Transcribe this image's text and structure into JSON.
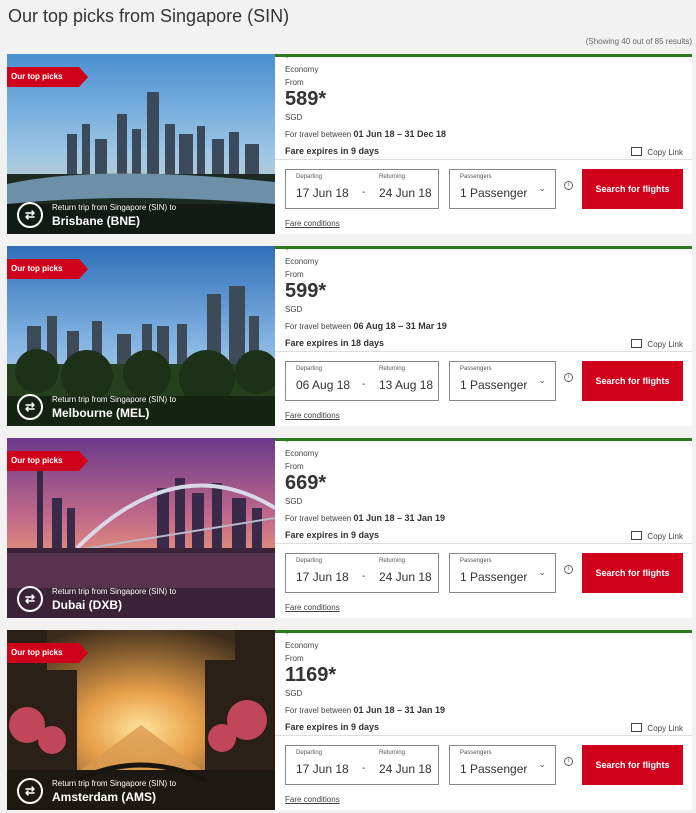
{
  "page": {
    "title": "Our top picks from Singapore (SIN)",
    "results": "(Showing 40 out of 85 results)"
  },
  "common": {
    "badge": "Our top picks",
    "route_prefix": "Return trip from Singapore (SIN) to",
    "cabin": "Economy",
    "from": "From",
    "currency": "SGD",
    "travel_prefix": "For travel between",
    "copy_link": "Copy Link",
    "departing_label": "Departing",
    "returning_label": "Returning",
    "passengers_label": "Passengers",
    "passengers_value": "1 Passenger",
    "search_button": "Search for flights",
    "fare_conditions": "Fare conditions",
    "date_separator": "-",
    "info_glyph": "i"
  },
  "deals": [
    {
      "city": "Brisbane (BNE)",
      "price": "589*",
      "travel_dates": "01 Jun 18 – 31 Dec 18",
      "expires": "Fare expires in 9 days",
      "depart": "17 Jun 18",
      "return": "24 Jun 18"
    },
    {
      "city": "Melbourne (MEL)",
      "price": "599*",
      "travel_dates": "06 Aug 18 – 31 Mar 19",
      "expires": "Fare expires in 18 days",
      "depart": "06 Aug 18",
      "return": "13 Aug 18"
    },
    {
      "city": "Dubai (DXB)",
      "price": "669*",
      "travel_dates": "01 Jun 18 – 31 Jan 19",
      "expires": "Fare expires in 9 days",
      "depart": "17 Jun 18",
      "return": "24 Jun 18"
    },
    {
      "city": "Amsterdam (AMS)",
      "price": "1169*",
      "travel_dates": "01 Jun 18 – 31 Jan 19",
      "expires": "Fare expires in 9 days",
      "depart": "17 Jun 18",
      "return": "24 Jun 18"
    }
  ],
  "colors": {
    "brand_red": "#d0021b",
    "accent_green": "#2d7a1f"
  },
  "icons": {
    "route": "return-trip-icon",
    "copy": "copy-link-icon",
    "chevron": "chevron-down-icon",
    "info": "info-icon"
  }
}
